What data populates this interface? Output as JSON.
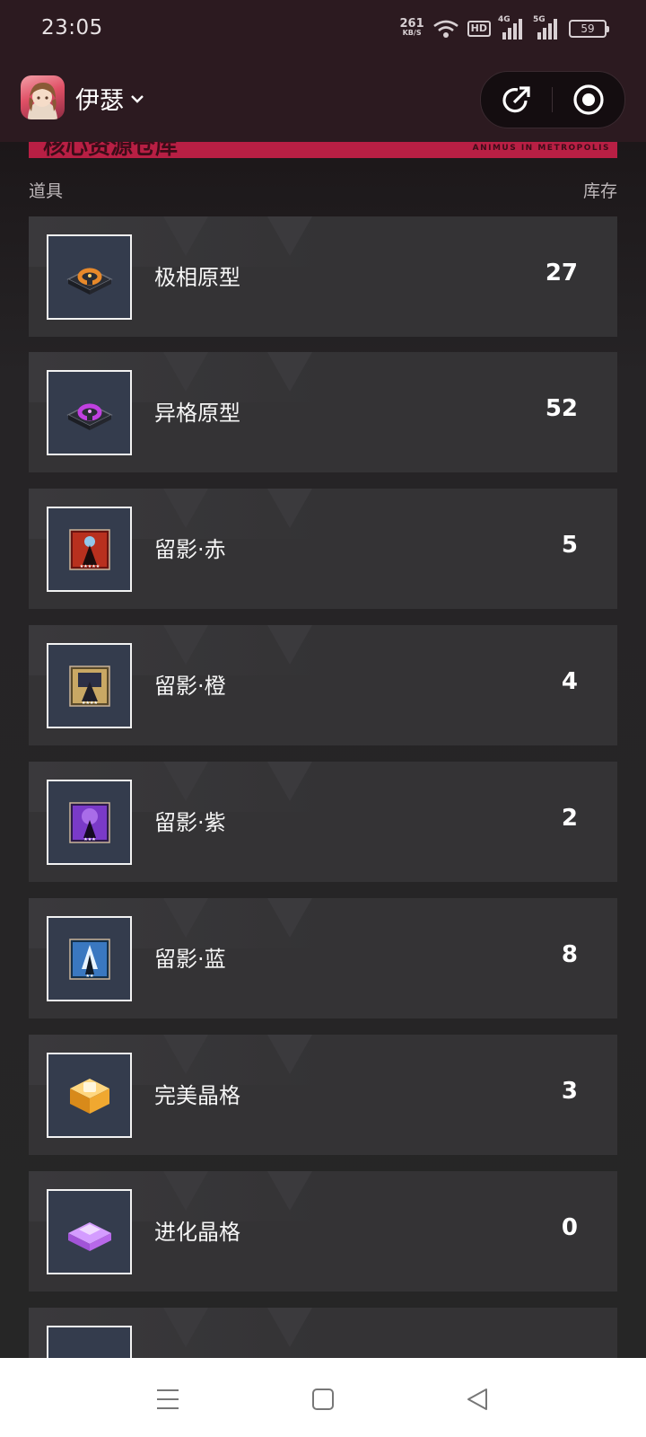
{
  "status_bar": {
    "time": "23:05",
    "net_speed_value": "261",
    "net_speed_unit": "KB/S",
    "hd_label": "HD",
    "signal_1_label": "4G",
    "signal_2_label": "5G",
    "battery": "59",
    "icons": [
      "wifi-icon",
      "signal-icon",
      "battery-icon"
    ]
  },
  "header": {
    "account_name": "伊瑟",
    "icons": [
      "avatar",
      "chevron-down-icon",
      "share-icon",
      "record-icon"
    ]
  },
  "banner": {
    "title": "核心资源仓库",
    "subtitle": "ANIMUS IN METROPOLIS",
    "color": "#b81f44"
  },
  "table": {
    "col_item": "道具",
    "col_stock": "库存"
  },
  "items": [
    {
      "name": "极相原型",
      "count": "27",
      "icon": "orange-prototype-icon"
    },
    {
      "name": "异格原型",
      "count": "52",
      "icon": "purple-prototype-icon"
    },
    {
      "name": "留影·赤",
      "count": "5",
      "icon": "red-shadow-card-icon"
    },
    {
      "name": "留影·橙",
      "count": "4",
      "icon": "orange-shadow-card-icon"
    },
    {
      "name": "留影·紫",
      "count": "2",
      "icon": "purple-shadow-card-icon"
    },
    {
      "name": "留影·蓝",
      "count": "8",
      "icon": "blue-shadow-card-icon"
    },
    {
      "name": "完美晶格",
      "count": "3",
      "icon": "gold-crystal-icon"
    },
    {
      "name": "进化晶格",
      "count": "0",
      "icon": "purple-crystal-icon"
    },
    {
      "name": "",
      "count": "",
      "icon": "item-icon"
    }
  ],
  "nav_bar": {
    "icons": [
      "menu-icon",
      "home-icon",
      "back-icon"
    ]
  }
}
